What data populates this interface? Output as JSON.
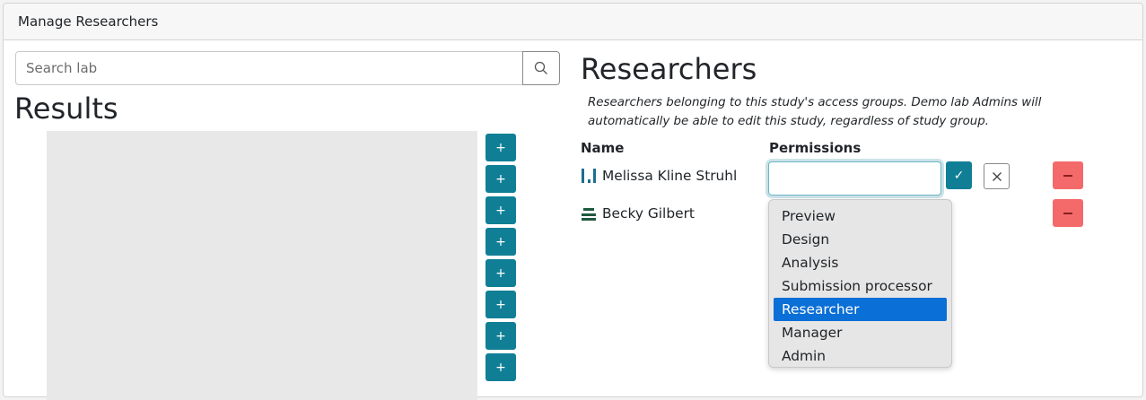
{
  "header": {
    "title": "Manage Researchers"
  },
  "search": {
    "placeholder": "Search lab"
  },
  "results": {
    "heading": "Results",
    "add_buttons": [
      "+",
      "+",
      "+",
      "+",
      "+",
      "+",
      "+",
      "+"
    ]
  },
  "researchers": {
    "heading": "Researchers",
    "description": "Researchers belonging to this study's access groups. Demo lab Admins will automatically be able to edit this study, regardless of study group.",
    "col_name": "Name",
    "col_permissions": "Permissions",
    "rows": [
      {
        "name": "Melissa Kline Struhl",
        "avatar": "bars-avatar-icon"
      },
      {
        "name": "Becky Gilbert",
        "avatar": "stack-avatar-icon"
      }
    ],
    "permission_input": {
      "value": ""
    },
    "confirm_label": "✓",
    "remove_label": "−"
  },
  "dropdown": {
    "options": [
      "Preview",
      "Design",
      "Analysis",
      "Submission processor",
      "Researcher",
      "Manager",
      "Admin"
    ],
    "highlighted": "Researcher"
  },
  "colors": {
    "primary": "#107f96",
    "danger": "#f46a6a",
    "selected": "#0a6fd6",
    "avatar_bars": "#1d6e8f",
    "avatar_stack": "#1f5a3e"
  }
}
